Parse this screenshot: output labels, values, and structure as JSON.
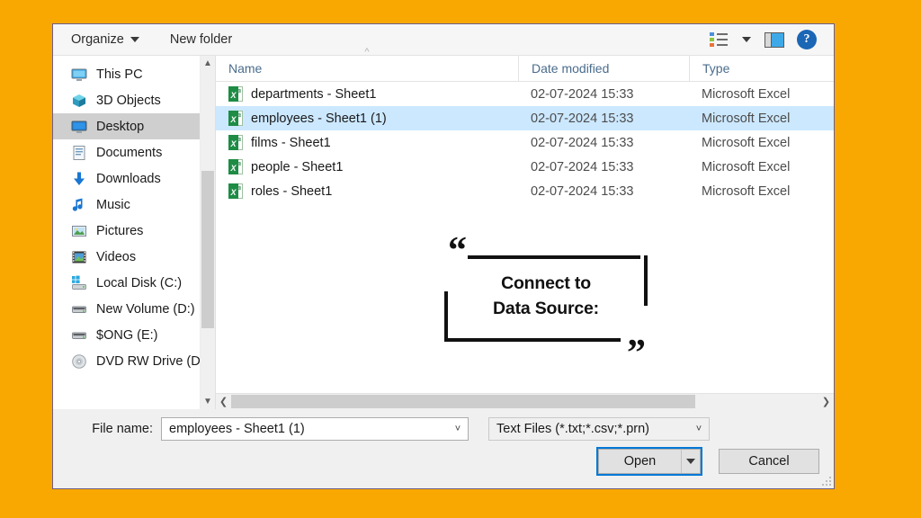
{
  "background_color": "#F8A800",
  "toolbar": {
    "organize_label": "Organize",
    "new_folder_label": "New folder",
    "view_options_icon": "list-view-icon",
    "view_caret_icon": "chevron-down-icon",
    "preview_pane_icon": "preview-pane-icon",
    "help_label": "?"
  },
  "nav_pane": {
    "items": [
      {
        "label": "This PC",
        "icon": "monitor-icon",
        "selected": false
      },
      {
        "label": "3D Objects",
        "icon": "cube-icon",
        "selected": false
      },
      {
        "label": "Desktop",
        "icon": "desktop-icon",
        "selected": true
      },
      {
        "label": "Documents",
        "icon": "document-icon",
        "selected": false
      },
      {
        "label": "Downloads",
        "icon": "download-arrow-icon",
        "selected": false
      },
      {
        "label": "Music",
        "icon": "music-note-icon",
        "selected": false
      },
      {
        "label": "Pictures",
        "icon": "picture-icon",
        "selected": false
      },
      {
        "label": "Videos",
        "icon": "video-film-icon",
        "selected": false
      },
      {
        "label": "Local Disk (C:)",
        "icon": "windows-drive-icon",
        "selected": false
      },
      {
        "label": "New Volume (D:)",
        "icon": "drive-icon",
        "selected": false
      },
      {
        "label": "$ONG (E:)",
        "icon": "drive-icon",
        "selected": false
      },
      {
        "label": "DVD RW Drive (D",
        "icon": "optical-disc-icon",
        "selected": false
      }
    ],
    "scroll_up_icon": "chevron-up-icon",
    "scroll_down_icon": "chevron-down-icon"
  },
  "file_list": {
    "columns": [
      "Name",
      "Date modified",
      "Type"
    ],
    "sort_indicator": "ascending",
    "rows": [
      {
        "name": "departments - Sheet1",
        "date": "02-07-2024 15:33",
        "type": "Microsoft Excel",
        "selected": false
      },
      {
        "name": "employees - Sheet1 (1)",
        "date": "02-07-2024 15:33",
        "type": "Microsoft Excel",
        "selected": true
      },
      {
        "name": "films - Sheet1",
        "date": "02-07-2024 15:33",
        "type": "Microsoft Excel",
        "selected": false
      },
      {
        "name": "people - Sheet1",
        "date": "02-07-2024 15:33",
        "type": "Microsoft Excel",
        "selected": false
      },
      {
        "name": "roles - Sheet1",
        "date": "02-07-2024 15:33",
        "type": "Microsoft Excel",
        "selected": false
      }
    ],
    "selection_color": "#CCE8FF",
    "scroll_left_icon": "chevron-left-icon",
    "scroll_right_icon": "chevron-right-icon"
  },
  "footer": {
    "file_name_label": "File name:",
    "file_name_value": "employees - Sheet1 (1)",
    "file_type_value": "Text Files (*.txt;*.csv;*.prn)",
    "open_label": "Open",
    "open_dropdown_icon": "caret-down-icon",
    "cancel_label": "Cancel",
    "focus_color": "#0078D7"
  },
  "callout": {
    "line1": "Connect to",
    "line2": "Data Source:",
    "quote_open": "“",
    "quote_close": "”"
  }
}
